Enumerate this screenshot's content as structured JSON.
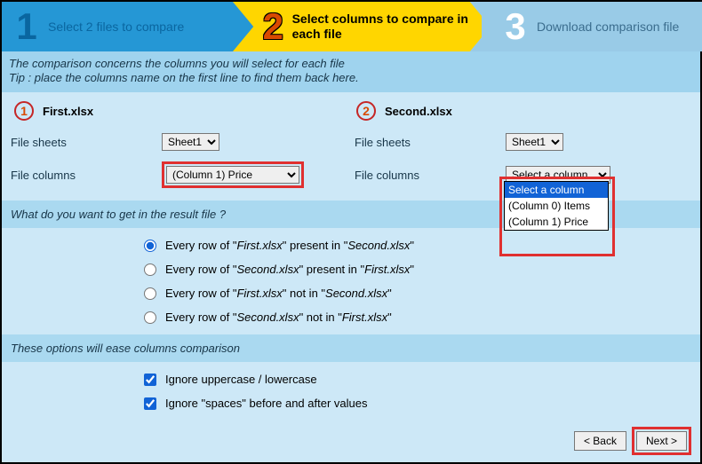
{
  "wizard": {
    "step1": {
      "num": "1",
      "text": "Select 2 files to compare"
    },
    "step2": {
      "num": "2",
      "text": "Select columns to compare in each file"
    },
    "step3": {
      "num": "3",
      "text": "Download comparison file"
    }
  },
  "info": {
    "line1": "The comparison concerns the columns you will select for each file",
    "line2": "Tip : place the columns name on the first line to find them back here."
  },
  "files": {
    "left": {
      "badge": "1",
      "name": "First.xlsx",
      "sheets_label": "File sheets",
      "sheets_value": "Sheet1",
      "cols_label": "File columns",
      "cols_value": "(Column 1) Price"
    },
    "right": {
      "badge": "2",
      "name": "Second.xlsx",
      "sheets_label": "File sheets",
      "sheets_value": "Sheet1",
      "cols_label": "File columns",
      "cols_value": "Select a column"
    }
  },
  "dropdown": {
    "items": [
      "Select a column",
      "(Column 0) Items",
      "(Column 1) Price"
    ]
  },
  "resultQuestion": "What do you want to get in the result file ?",
  "radios": {
    "r1": {
      "pre": "Every row of \"",
      "f1": "First.xlsx",
      "mid": "\" present in \"",
      "f2": "Second.xlsx",
      "post": "\""
    },
    "r2": {
      "pre": "Every row of \"",
      "f1": "Second.xlsx",
      "mid": "\" present in \"",
      "f2": "First.xlsx",
      "post": "\""
    },
    "r3": {
      "pre": "Every row of \"",
      "f1": "First.xlsx",
      "mid": "\" not in \"",
      "f2": "Second.xlsx",
      "post": "\""
    },
    "r4": {
      "pre": "Every row of \"",
      "f1": "Second.xlsx",
      "mid": "\" not in \"",
      "f2": "First.xlsx",
      "post": "\""
    }
  },
  "optsHeader": "These options will ease columns comparison",
  "checks": {
    "c1": "Ignore uppercase / lowercase",
    "c2": "Ignore \"spaces\" before and after values"
  },
  "footer": {
    "back": "< Back",
    "next": "Next >"
  }
}
